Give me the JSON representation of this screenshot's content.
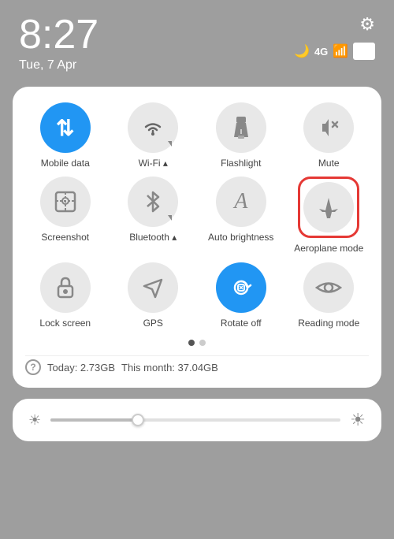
{
  "statusBar": {
    "time": "8:27",
    "date": "Tue, 7 Apr",
    "battery": "97",
    "gearLabel": "⚙"
  },
  "quickPanel": {
    "tiles": [
      {
        "id": "mobile-data",
        "label": "Mobile data",
        "icon": "⇅",
        "active": true
      },
      {
        "id": "wifi",
        "label": "Wi-Fi",
        "icon": "wifi",
        "active": false,
        "hasIndicator": true
      },
      {
        "id": "flashlight",
        "label": "Flashlight",
        "icon": "flashlight",
        "active": false
      },
      {
        "id": "mute",
        "label": "Mute",
        "icon": "bell",
        "active": false
      },
      {
        "id": "screenshot",
        "label": "Screenshot",
        "icon": "scissors",
        "active": false
      },
      {
        "id": "bluetooth",
        "label": "Bluetooth",
        "icon": "bluetooth",
        "active": false,
        "hasIndicator": true
      },
      {
        "id": "auto-brightness",
        "label": "Auto brightness",
        "icon": "A",
        "active": false
      },
      {
        "id": "aeroplane-mode",
        "label": "Aeroplane mode",
        "icon": "plane",
        "active": false,
        "highlighted": true
      },
      {
        "id": "lock-screen",
        "label": "Lock screen",
        "icon": "lock",
        "active": false
      },
      {
        "id": "gps",
        "label": "GPS",
        "icon": "gps",
        "active": false
      },
      {
        "id": "rotate-off",
        "label": "Rotate off",
        "icon": "rotate",
        "active": true
      },
      {
        "id": "reading-mode",
        "label": "Reading mode",
        "icon": "eye",
        "active": false
      }
    ],
    "dataUsage": {
      "today": "Today: 2.73GB",
      "month": "This month: 37.04GB"
    },
    "pageDots": [
      true,
      false
    ]
  },
  "brightness": {
    "value": 30
  }
}
